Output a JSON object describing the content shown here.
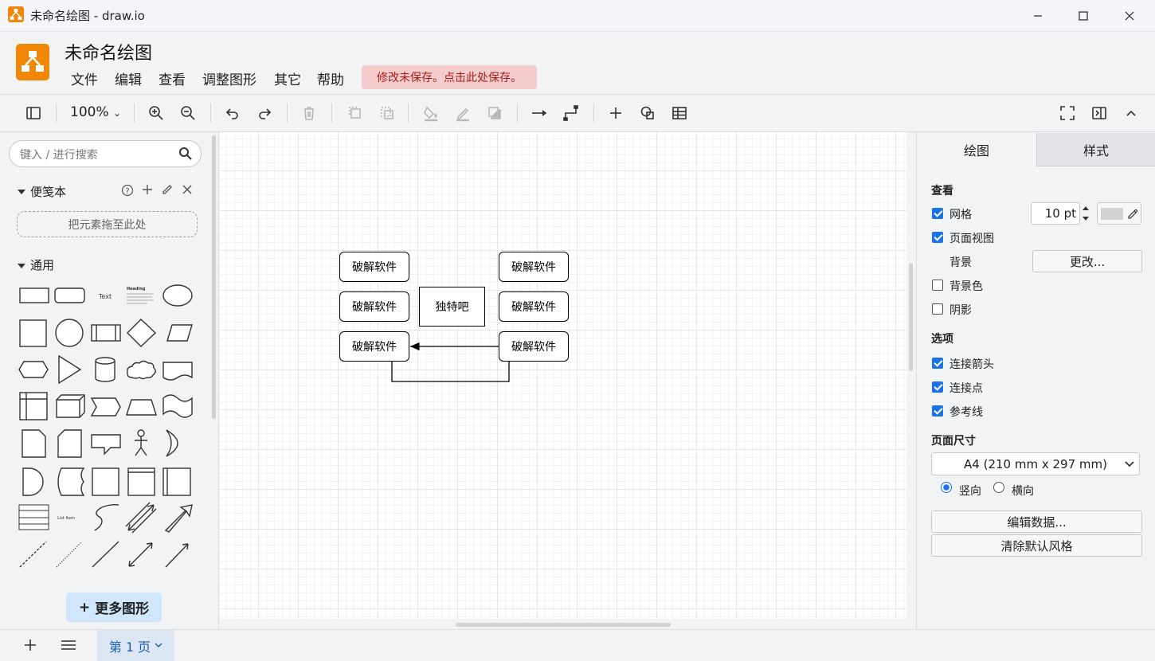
{
  "window": {
    "title": "未命名绘图 - draw.io",
    "minimize_icon": "minimize-icon",
    "maximize_icon": "maximize-icon",
    "close_icon": "close-icon"
  },
  "header": {
    "doc_title": "未命名绘图",
    "menu": [
      "文件",
      "编辑",
      "查看",
      "调整图形",
      "其它",
      "帮助"
    ],
    "unsaved_notice": "修改未保存。点击此处保存。"
  },
  "toolbar": {
    "zoom": "100%",
    "icons": [
      "sidebar-toggle-icon",
      "zoom-in-icon",
      "zoom-out-icon",
      "undo-icon",
      "redo-icon",
      "delete-icon",
      "to-front-icon",
      "to-back-icon",
      "fill-color-icon",
      "line-color-icon",
      "shadow-icon",
      "connection-icon",
      "waypoints-icon",
      "insert-icon",
      "shapes-icon",
      "table-icon",
      "fullscreen-icon",
      "format-panel-icon",
      "collapse-icon"
    ]
  },
  "sidebar": {
    "search_placeholder": "键入 / 进行搜索",
    "scratchpad_title": "便笺本",
    "scratchpad_drop": "把元素拖至此处",
    "general_title": "通用",
    "more_shapes": "更多图形",
    "shape_text_label": "Text",
    "shape_heading_label": "Heading",
    "shape_list_item_label": "List Item"
  },
  "diagram": {
    "nodes": [
      "破解软件",
      "破解软件",
      "破解软件",
      "破解软件",
      "破解软件",
      "破解软件"
    ],
    "center_node": "独特吧"
  },
  "right_panel": {
    "tabs": [
      "绘图",
      "样式"
    ],
    "view_title": "查看",
    "grid_label": "网格",
    "grid_size": "10 pt",
    "page_view_label": "页面视图",
    "background_label": "背景",
    "change_button": "更改...",
    "bg_color_label": "背景色",
    "shadow_label": "阴影",
    "options_title": "选项",
    "connection_arrows_label": "连接箭头",
    "connection_points_label": "连接点",
    "guides_label": "参考线",
    "page_size_title": "页面尺寸",
    "page_size_value": "A4 (210 mm x 297 mm)",
    "portrait_label": "竖向",
    "landscape_label": "横向",
    "edit_data_button": "编辑数据...",
    "clear_style_button": "清除默认风格",
    "checks": {
      "grid": true,
      "page_view": true,
      "bg_color": false,
      "shadow": false,
      "arrows": true,
      "points": true,
      "guides": true
    },
    "orientation": "portrait"
  },
  "footer": {
    "page_tab": "第 1 页"
  },
  "colors": {
    "accent": "#1a73e8",
    "brand": "#f08705",
    "unsaved_bg": "#f4cccc",
    "unsaved_text": "#a61c1c"
  }
}
